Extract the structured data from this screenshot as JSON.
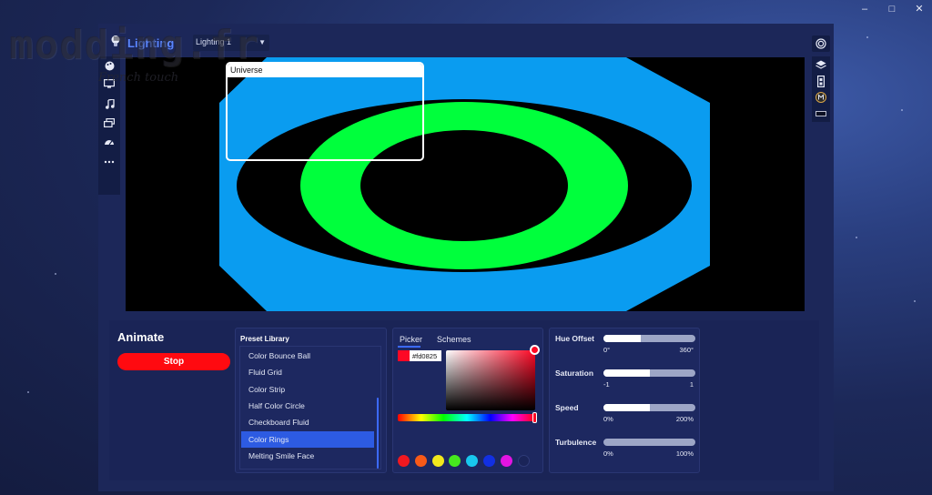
{
  "watermark": {
    "brand": "modding.fr",
    "tagline": "French touch"
  },
  "window_controls": {
    "minimize": "–",
    "maximize": "□",
    "close": "✕"
  },
  "header": {
    "title": "Lighting",
    "profile": "Lighting 1"
  },
  "canvas": {
    "overlay_title": "Universe",
    "colors": {
      "outer": "#0a9cf0",
      "ring": "#00ff3c",
      "background": "#000000"
    }
  },
  "animate": {
    "title": "Animate",
    "stop_label": "Stop",
    "stop_color": "#ff0a10"
  },
  "presets": {
    "title": "Preset Library",
    "items": [
      "Color Bounce Ball",
      "Fluid Grid",
      "Color Strip",
      "Half Color Circle",
      "Checkboard Fluid",
      "Color Rings",
      "Melting Smile Face"
    ],
    "selected": "Color Rings"
  },
  "picker": {
    "tabs": [
      "Picker",
      "Schemes"
    ],
    "active_tab": "Picker",
    "hex": "#fd0825",
    "swatches": [
      "#f01820",
      "#f85a18",
      "#f2e81c",
      "#46e81e",
      "#18c8ee",
      "#1230e2",
      "#e214e2",
      "#1a2458"
    ]
  },
  "sliders": [
    {
      "label": "Hue Offset",
      "min": "0°",
      "max": "360°",
      "value": 0.41
    },
    {
      "label": "Saturation",
      "min": "-1",
      "max": "1",
      "value": 0.5
    },
    {
      "label": "Speed",
      "min": "0%",
      "max": "200%",
      "value": 0.5
    },
    {
      "label": "Turbulence",
      "min": "0%",
      "max": "100%",
      "value": 0.0
    }
  ]
}
